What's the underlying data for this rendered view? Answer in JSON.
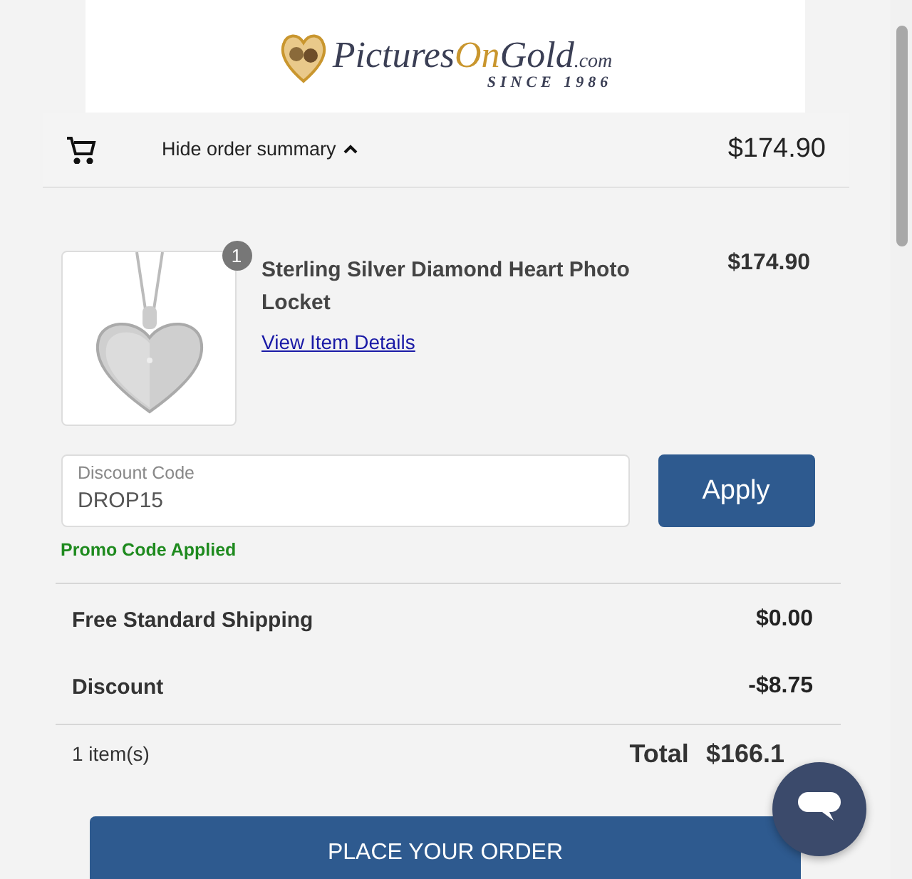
{
  "logo": {
    "parts": [
      {
        "text": "Pictures",
        "kind": "dark"
      },
      {
        "text": "On",
        "kind": "gold"
      },
      {
        "text": "Gold",
        "kind": "dark"
      }
    ],
    "suffix": ".com",
    "tagline": "SINCE 1986"
  },
  "summary_bar": {
    "toggle": "Hide order summary",
    "expanded": true,
    "amount": "$174.90"
  },
  "item": {
    "quantity": "1",
    "name": "Sterling Silver Diamond Heart Photo Locket",
    "link": "View Item Details",
    "price": "$174.90"
  },
  "discount": {
    "label": "Discount Code",
    "value": "DROP15",
    "button": "Apply",
    "message": "Promo Code Applied"
  },
  "lines": [
    {
      "label": "Free Standard Shipping",
      "amount": "$0.00"
    },
    {
      "label": "Discount",
      "amount": "-$8.75"
    }
  ],
  "totals": {
    "count": "1 item(s)",
    "label": "Total",
    "amount": "$166.1"
  },
  "place_order": "PLACE YOUR ORDER"
}
